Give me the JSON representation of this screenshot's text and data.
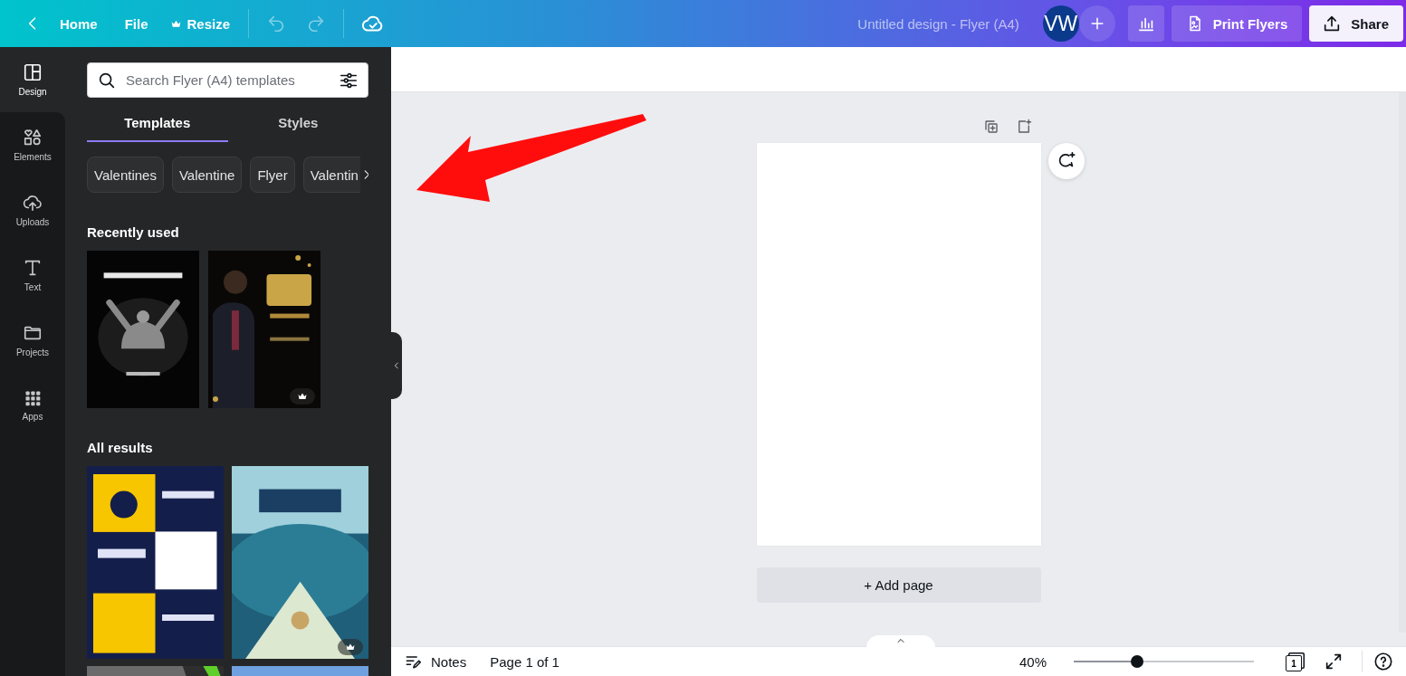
{
  "topbar": {
    "back_label": "Home",
    "menu": [
      {
        "label": "File",
        "kind": "text"
      },
      {
        "label": "Resize",
        "kind": "premium"
      }
    ],
    "history": [
      {
        "kind": "undo",
        "disabled": true
      },
      {
        "kind": "redo",
        "disabled": true
      }
    ],
    "title": "Untitled design - Flyer (A4)",
    "avatar": "VW",
    "print_label": "Print Flyers",
    "share_label": "Share"
  },
  "rail": [
    {
      "label": "Design",
      "selected": true
    },
    {
      "label": "Elements",
      "selected": false
    },
    {
      "label": "Uploads",
      "selected": false
    },
    {
      "label": "Text",
      "selected": false
    },
    {
      "label": "Projects",
      "selected": false
    },
    {
      "label": "Apps",
      "selected": false
    }
  ],
  "panel": {
    "search": {
      "placeholder": "Search Flyer (A4) templates"
    },
    "tabs": [
      {
        "label": "Templates",
        "selected": true
      },
      {
        "label": "Styles",
        "selected": false
      }
    ],
    "chips": [
      "Valentines",
      "Valentine",
      "Flyer",
      "Valentin"
    ],
    "sections": [
      {
        "title": "Recently used",
        "items": [
          {
            "kind": "picture",
            "premium": false
          },
          {
            "kind": "picture",
            "premium": true
          }
        ]
      },
      {
        "title": "All results",
        "items": [
          {
            "kind": "picture",
            "premium": false
          },
          {
            "kind": "picture",
            "premium": true
          },
          {
            "kind": "picture",
            "premium": false
          },
          {
            "kind": "picture",
            "premium": false
          }
        ]
      }
    ]
  },
  "canvas": {
    "add_page": "+ Add page"
  },
  "footer": {
    "notes": "Notes",
    "page": "Page 1 of 1",
    "zoom": "40%",
    "level": 0.35,
    "page_count": "1"
  }
}
